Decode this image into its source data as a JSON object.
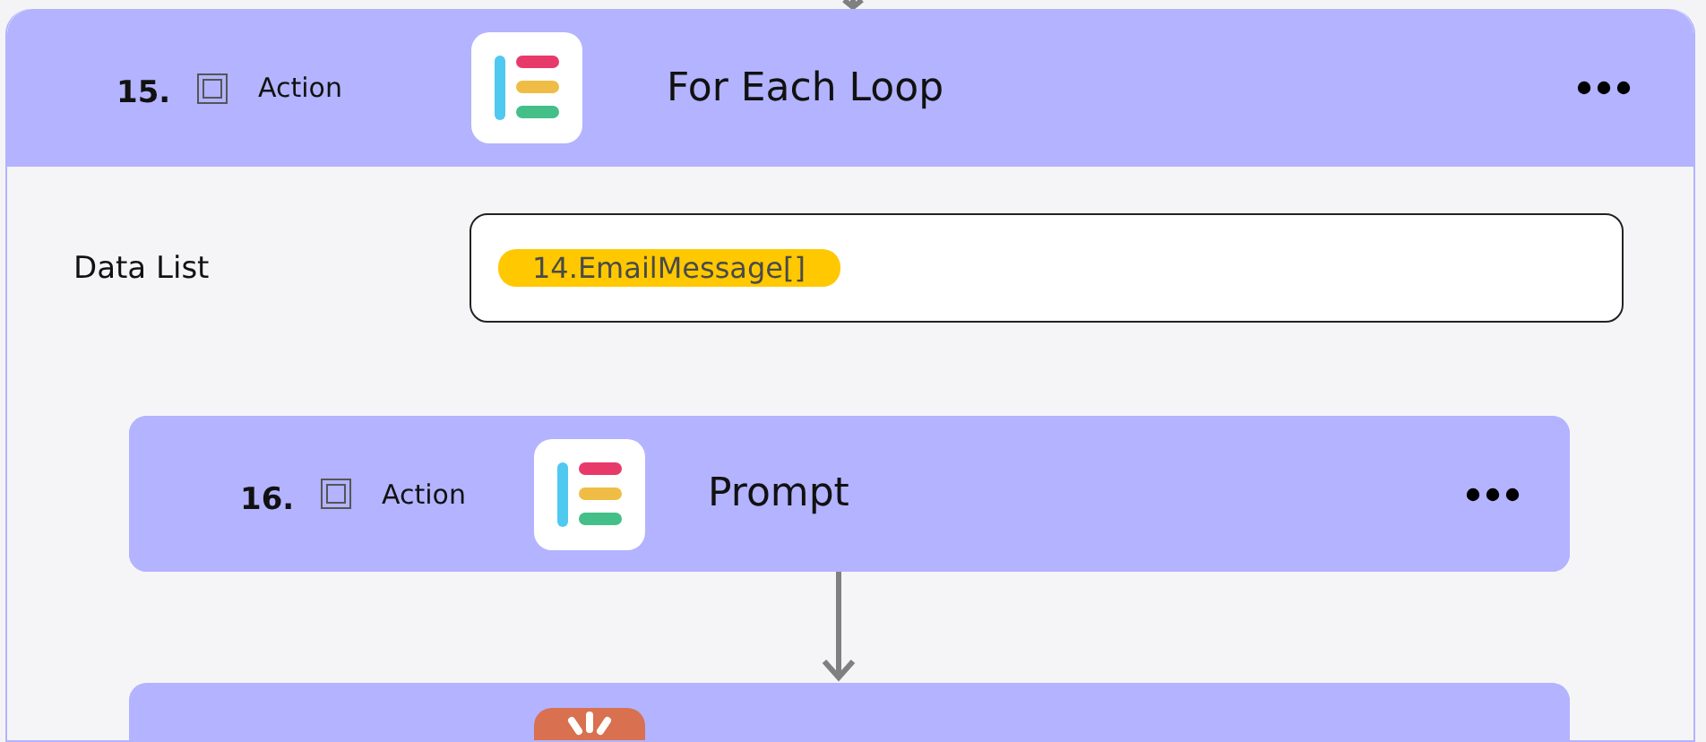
{
  "loop": {
    "number": "15.",
    "checked": false,
    "type_label": "Action",
    "kind": "list",
    "title": "For Each Loop",
    "fields": [
      {
        "label": "Data List",
        "tokens": [
          "14.EmailMessage[]"
        ]
      }
    ],
    "children": [
      {
        "number": "16.",
        "checked": false,
        "type_label": "Action",
        "kind": "list",
        "title": "Prompt"
      },
      {
        "kind": "spark"
      }
    ]
  }
}
